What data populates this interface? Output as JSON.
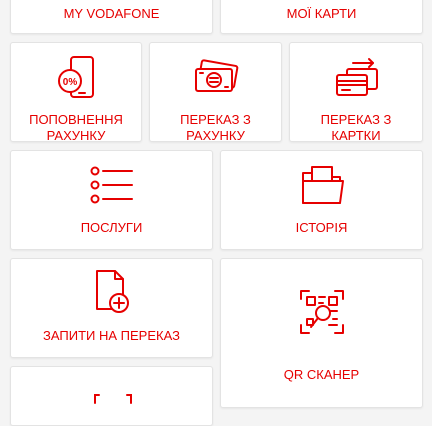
{
  "brand": {
    "accent": "#e60000",
    "tile_bg": "#ffffff",
    "page_bg": "#f4f4f4"
  },
  "tiles": [
    {
      "id": "my-vodafone",
      "label": "MY VODAFONE"
    },
    {
      "id": "my-cards",
      "label": "МОЇ КАРТИ"
    },
    {
      "id": "top-up",
      "label": "ПОПОВНЕННЯ РАХУНКУ",
      "icon": "phone-percent-icon"
    },
    {
      "id": "transfer-from-account",
      "label": "ПЕРЕКАЗ З РАХУНКУ",
      "icon": "money-hryvnia-icon"
    },
    {
      "id": "transfer-from-card",
      "label": "ПЕРЕКАЗ З КАРТКИ",
      "icon": "card-transfer-icon"
    },
    {
      "id": "services",
      "label": "ПОСЛУГИ",
      "icon": "list-icon"
    },
    {
      "id": "history",
      "label": "ІСТОРІЯ",
      "icon": "folder-icon"
    },
    {
      "id": "transfer-requests",
      "label": "ЗАПИТИ НА ПЕРЕКАЗ",
      "icon": "document-add-icon"
    },
    {
      "id": "qr-scanner",
      "label": "QR СКАНЕР",
      "icon": "qr-scan-icon"
    }
  ]
}
